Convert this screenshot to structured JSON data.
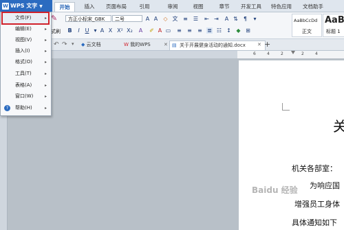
{
  "app": {
    "name": "WPS 文字",
    "logo": "W"
  },
  "menu_tabs": [
    "开始",
    "插入",
    "页面布局",
    "引用",
    "审阅",
    "视图",
    "章节",
    "开发工具",
    "特色应用",
    "文档助手"
  ],
  "ribbon": {
    "font_name": "方正小标宋_GBK",
    "font_size": "二号",
    "format_painter": "式刷",
    "style_preview_1": "AaBbCcDd",
    "style_label_1": "正文",
    "style_preview_2": "AaBb",
    "style_label_2": "标题 1"
  },
  "doc_tabs": {
    "cloud": "云文档",
    "mywps": "我的WPS",
    "active": "关于开展健身活动的通知.docx"
  },
  "ruler_numbers": [
    "6",
    "4",
    "2",
    "2",
    "4"
  ],
  "file_menu": {
    "items": [
      {
        "label": "文件(F)"
      },
      {
        "label": "编辑(E)"
      },
      {
        "label": "视图(V)"
      },
      {
        "label": "插入(I)"
      },
      {
        "label": "格式(O)"
      },
      {
        "label": "工具(T)"
      },
      {
        "label": "表格(A)"
      },
      {
        "label": "窗口(W)"
      },
      {
        "label": "帮助(H)"
      }
    ]
  },
  "document": {
    "title_char": "关",
    "line1": "机关各部室：",
    "line2": "为响应国",
    "line3": "增强员工身体",
    "line4": "具体通知如下"
  },
  "watermark": "Baidu 经验",
  "colors": {
    "accent": "#2b6bc0",
    "highlight": "#d0202a"
  }
}
